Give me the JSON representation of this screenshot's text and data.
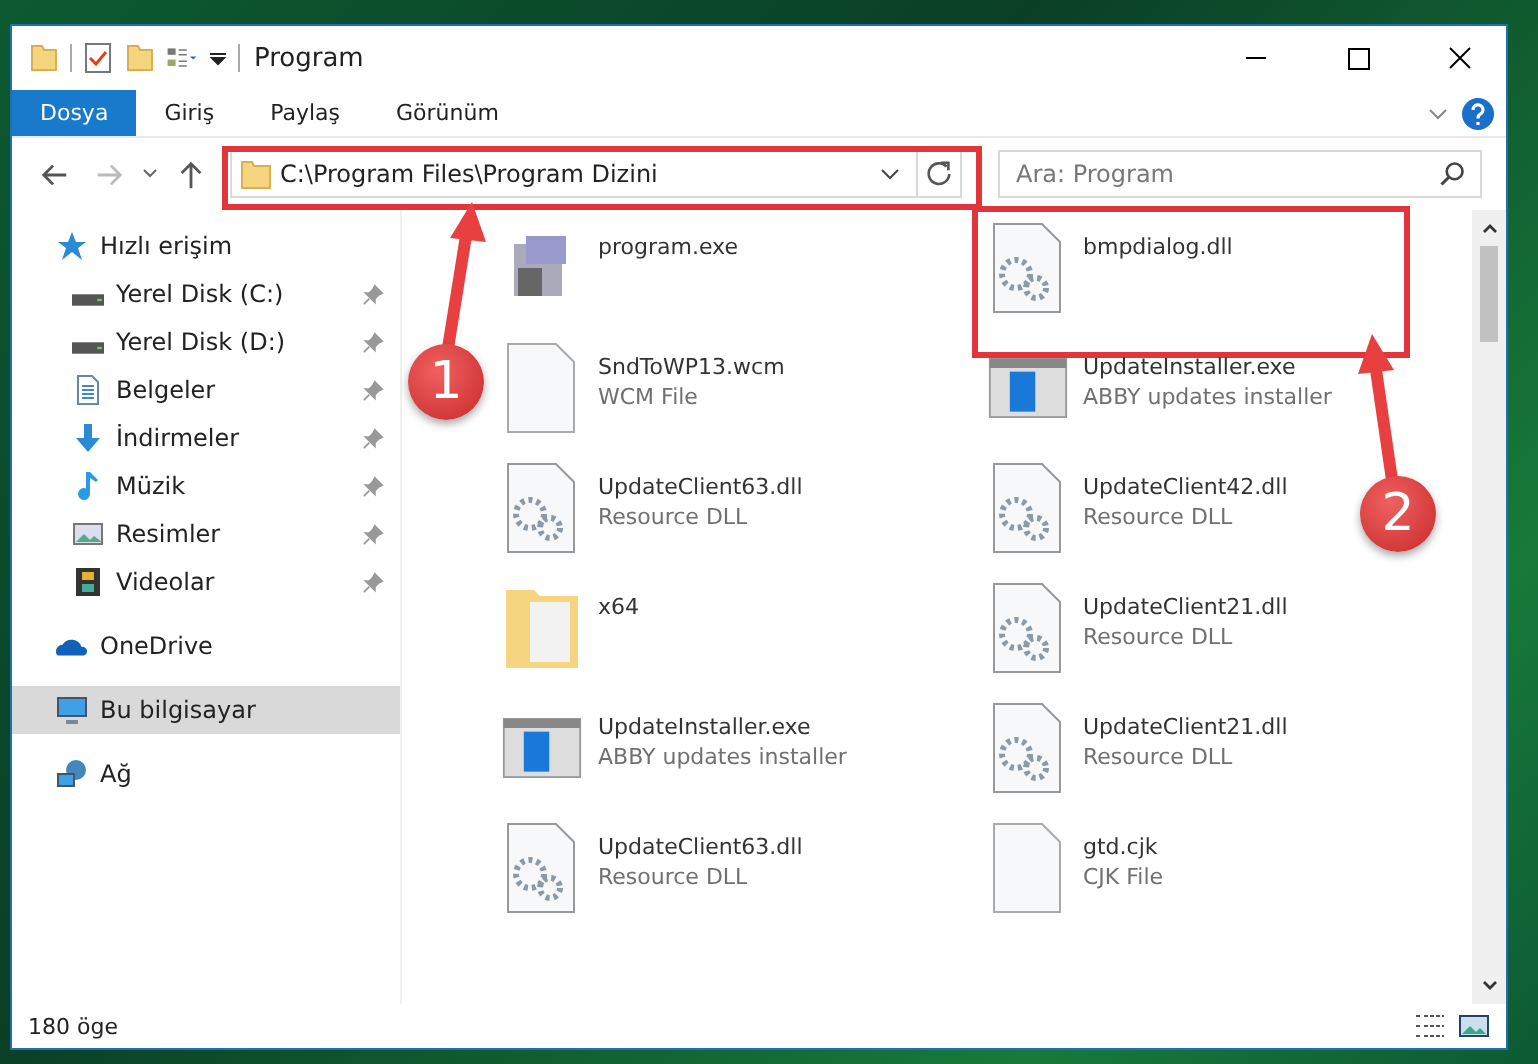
{
  "window": {
    "title": "Program"
  },
  "ribbon_tabs": [
    {
      "label": "Dosya",
      "selected": true
    },
    {
      "label": "Giriş",
      "selected": false
    },
    {
      "label": "Paylaş",
      "selected": false
    },
    {
      "label": "Görünüm",
      "selected": false
    }
  ],
  "address": {
    "path": "C:\\Program Files\\Program Dizini"
  },
  "search": {
    "placeholder": "Ara: Program"
  },
  "sidebar": {
    "items": [
      {
        "label": "Hızlı erişim",
        "kind": "star",
        "selected": false,
        "children": [
          {
            "label": "Yerel Disk (C:)",
            "kind": "drive",
            "pinned": true,
            "selected": false
          },
          {
            "label": "Yerel Disk (D:)",
            "kind": "drive",
            "pinned": true,
            "selected": false
          },
          {
            "label": "Belgeler",
            "kind": "document",
            "pinned": true,
            "selected": false
          },
          {
            "label": "İndirmeler",
            "kind": "download",
            "pinned": true,
            "selected": false
          },
          {
            "label": "Müzik",
            "kind": "music",
            "pinned": true,
            "selected": false
          },
          {
            "label": "Resimler",
            "kind": "picture",
            "pinned": true,
            "selected": false
          },
          {
            "label": "Videolar",
            "kind": "video",
            "pinned": true,
            "selected": false
          }
        ]
      },
      {
        "label": "OneDrive",
        "kind": "cloud",
        "selected": false
      },
      {
        "label": "Bu bilgisayar",
        "kind": "computer",
        "selected": true
      },
      {
        "label": "Ağ",
        "kind": "network",
        "selected": false
      }
    ]
  },
  "files": [
    {
      "name": "program.exe",
      "kind": "program",
      "highlighted": false
    },
    {
      "name": "bmpdialog.dll",
      "kind": "dll",
      "highlighted": true
    },
    {
      "name": "SndToWP13.wcm",
      "type": "WCM File",
      "kind": "blank",
      "highlighted": false
    },
    {
      "name": "UpdateInstaller.exe",
      "type": "ABBY updates installer",
      "kind": "installer",
      "highlighted": false
    },
    {
      "name": "UpdateClient63.dll",
      "type": "Resource DLL",
      "kind": "dll",
      "highlighted": false
    },
    {
      "name": "UpdateClient42.dll",
      "type": "Resource DLL",
      "kind": "dll",
      "highlighted": false
    },
    {
      "name": "x64",
      "kind": "folder",
      "highlighted": false
    },
    {
      "name": "UpdateClient21.dll",
      "type": "Resource DLL",
      "kind": "dll",
      "highlighted": false
    },
    {
      "name": "UpdateInstaller.exe",
      "type": "ABBY updates installer",
      "kind": "installer",
      "highlighted": false
    },
    {
      "name": "UpdateClient21.dll",
      "type": "Resource DLL",
      "kind": "dll",
      "highlighted": false
    },
    {
      "name": "UpdateClient63.dll",
      "type": "Resource DLL",
      "kind": "dll",
      "highlighted": false
    },
    {
      "name": "gtd.cjk",
      "type": "CJK File",
      "kind": "blank",
      "highlighted": false
    }
  ],
  "status_bar": {
    "text": "180 öge"
  },
  "callouts": [
    {
      "number": "1"
    },
    {
      "number": "2"
    }
  ]
}
